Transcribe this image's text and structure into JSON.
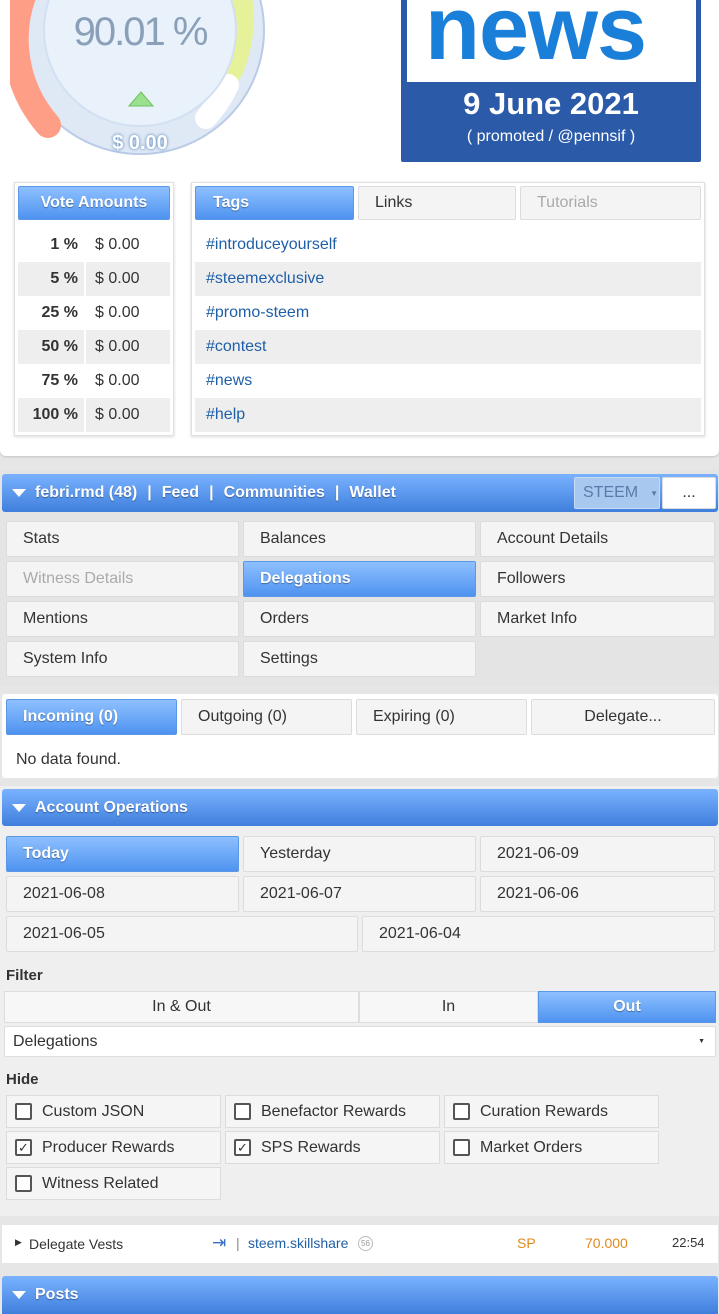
{
  "gauge": {
    "percent": "90.01 %",
    "value": "$ 0.00"
  },
  "banner": {
    "word": "news",
    "date": "9 June 2021",
    "sub": "( promoted / @pennsif )"
  },
  "vote": {
    "title": "Vote Amounts",
    "rows": [
      {
        "p": "1 %",
        "v": "$ 0.00"
      },
      {
        "p": "5 %",
        "v": "$ 0.00"
      },
      {
        "p": "25 %",
        "v": "$ 0.00"
      },
      {
        "p": "50 %",
        "v": "$ 0.00"
      },
      {
        "p": "75 %",
        "v": "$ 0.00"
      },
      {
        "p": "100 %",
        "v": "$ 0.00"
      }
    ]
  },
  "tagtabs": {
    "tags": "Tags",
    "links": "Links",
    "tutorials": "Tutorials"
  },
  "tags": [
    "#introduceyourself",
    "#steemexclusive",
    "#promo-steem",
    "#contest",
    "#news",
    "#help"
  ],
  "nav": {
    "user": "febri.rmd (48)",
    "sep": "|",
    "feed": "Feed",
    "communities": "Communities",
    "wallet": "Wallet",
    "currency": "STEEM",
    "more": "..."
  },
  "menu": [
    "Stats",
    "Balances",
    "Account Details",
    "Witness Details",
    "Delegations",
    "Followers",
    "Mentions",
    "Orders",
    "Market Info",
    "System Info",
    "Settings"
  ],
  "deleg": {
    "incoming": "Incoming (0)",
    "outgoing": "Outgoing (0)",
    "expiring": "Expiring (0)",
    "delegate": "Delegate...",
    "empty": "No data found."
  },
  "ops": {
    "title": "Account Operations",
    "dates": [
      "Today",
      "Yesterday",
      "2021-06-09",
      "2021-06-08",
      "2021-06-07",
      "2021-06-06",
      "2021-06-05",
      "2021-06-04"
    ]
  },
  "filter": {
    "label": "Filter",
    "inout": "In & Out",
    "in": "In",
    "out": "Out",
    "select": "Delegations"
  },
  "hide": {
    "label": "Hide",
    "items": [
      {
        "t": "Custom JSON",
        "c": false
      },
      {
        "t": "Benefactor Rewards",
        "c": false
      },
      {
        "t": "Curation Rewards",
        "c": false
      },
      {
        "t": "Producer Rewards",
        "c": true
      },
      {
        "t": "SPS Rewards",
        "c": true
      },
      {
        "t": "Market Orders",
        "c": false
      },
      {
        "t": "Witness Related",
        "c": false
      }
    ]
  },
  "op": {
    "type": "Delegate Vests",
    "sep": "|",
    "account": "steem.skillshare",
    "rep": "56",
    "unit": "SP",
    "amount": "70.000",
    "time": "22:54"
  },
  "posts": {
    "title": "Posts"
  },
  "colors": {
    "accent": "#4e93f0",
    "link": "#1f5fa8",
    "orange": "#e08a1e",
    "banner": "#2a5aa8"
  }
}
